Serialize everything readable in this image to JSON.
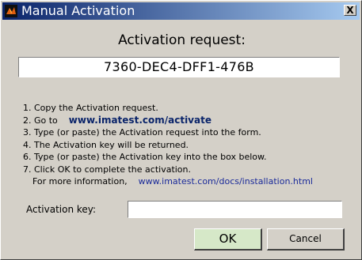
{
  "window": {
    "title": "Manual Activation",
    "close_glyph": "X",
    "icon": "matlab-icon"
  },
  "request": {
    "heading": "Activation request:",
    "value": "7360-DEC4-DFF1-476B"
  },
  "instructions": {
    "step1": "1. Copy the Activation request.",
    "step2_prefix": "2. Go to",
    "step2_link": "www.imatest.com/activate",
    "step3": "3. Type (or paste) the Activation request into the form.",
    "step4": "4. The Activation key will be returned.",
    "step6": "6. Type (or paste) the Activation key into the box below.",
    "step7": "7. Click OK to complete the activation.",
    "more_prefix": "For more information,",
    "more_link": "www.imatest.com/docs/installation.html"
  },
  "key": {
    "label": "Activation key:",
    "value": "",
    "placeholder": ""
  },
  "buttons": {
    "ok": "OK",
    "cancel": "Cancel"
  },
  "colors": {
    "titlebar_start": "#0a246a",
    "titlebar_end": "#a6caf0",
    "dialog_bg": "#d4d0c8",
    "ok_bg": "#d6e8c8",
    "link": "#0a246a"
  }
}
